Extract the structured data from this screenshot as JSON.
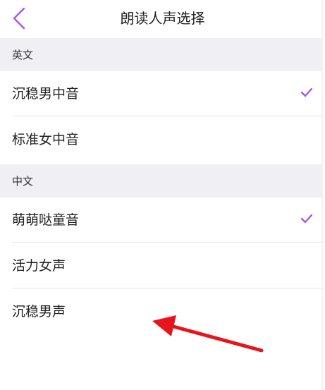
{
  "nav": {
    "title": "朗读人声选择",
    "back_icon": "chevron-left-icon"
  },
  "colors": {
    "accent": "#a855e8",
    "section_bg": "#efeff4",
    "annotation_arrow": "#e8141c"
  },
  "sections": [
    {
      "header": "英文",
      "items": [
        {
          "label": "沉稳男中音",
          "selected": true
        },
        {
          "label": "标准女中音",
          "selected": false
        }
      ]
    },
    {
      "header": "中文",
      "items": [
        {
          "label": "萌萌哒童音",
          "selected": true
        },
        {
          "label": "活力女声",
          "selected": false
        },
        {
          "label": "沉稳男声",
          "selected": false
        }
      ]
    }
  ],
  "annotation": {
    "icon": "red-arrow-annotation",
    "points_to": "沉稳男声"
  }
}
